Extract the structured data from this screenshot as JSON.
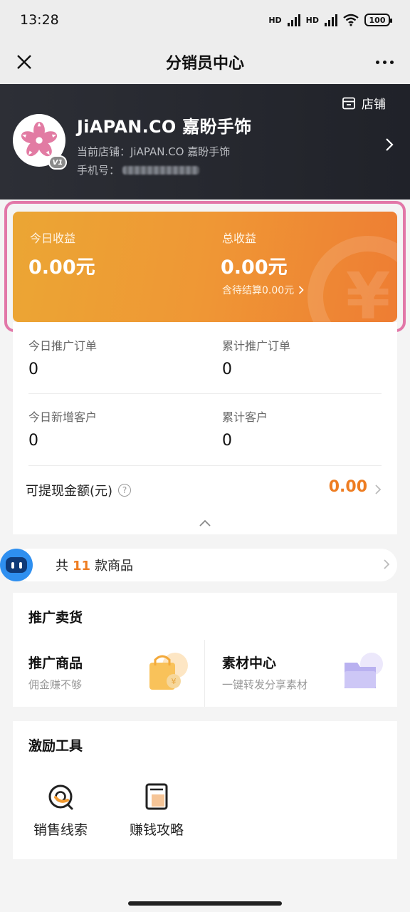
{
  "status_bar": {
    "time": "13:28",
    "network1": "HD",
    "network2": "HD",
    "battery": "100"
  },
  "nav": {
    "title": "分销员中心"
  },
  "header": {
    "shop_link_label": "店铺",
    "shop_name": "JiAPAN.CO 嘉盼手饰",
    "current_shop": "当前店铺：JiAPAN.CO 嘉盼手饰",
    "phone_label": "手机号：",
    "level_badge": "V1"
  },
  "earnings": {
    "today_label": "今日收益",
    "today_value": "0.00元",
    "total_label": "总收益",
    "total_value": "0.00元",
    "pending_text": "含待结算0.00元",
    "watermark": "¥"
  },
  "stats": {
    "today_orders_label": "今日推广订单",
    "today_orders_value": "0",
    "total_orders_label": "累计推广订单",
    "total_orders_value": "0",
    "today_customers_label": "今日新增客户",
    "today_customers_value": "0",
    "total_customers_label": "累计客户",
    "total_customers_value": "0",
    "withdraw_label": "可提现金额(元)",
    "withdraw_help": "?",
    "withdraw_value": "0.00"
  },
  "products": {
    "prefix": "共",
    "count": "11",
    "suffix": "款商品"
  },
  "promo": {
    "title": "推广卖货",
    "item1_title": "推广商品",
    "item1_sub": "佣金赚不够",
    "item2_title": "素材中心",
    "item2_sub": "一键转发分享素材"
  },
  "incentive": {
    "title": "激励工具",
    "tool1_label": "销售线索",
    "tool2_label": "赚钱攻略"
  },
  "colors": {
    "accent_orange": "#ee7d22",
    "highlight_pink": "#e277a8",
    "header_dark": "#2d2f36"
  }
}
